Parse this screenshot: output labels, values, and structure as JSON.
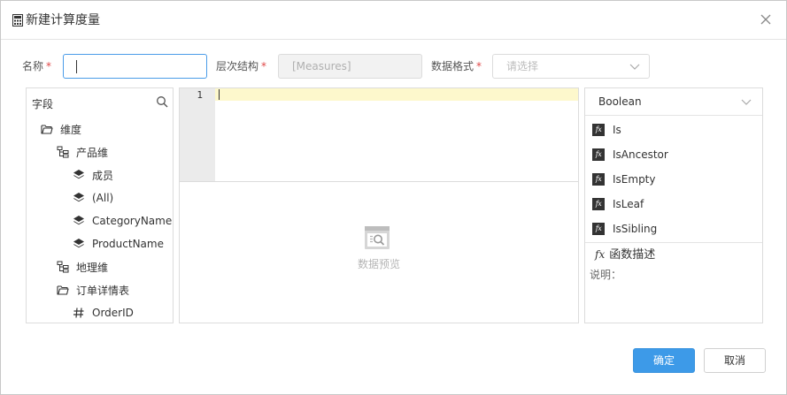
{
  "dialog": {
    "title": "新建计算度量",
    "icon": "calculator-icon",
    "close_icon": "close-icon"
  },
  "form": {
    "name_label": "名称",
    "required_mark": "*",
    "name_value": "",
    "hierarchy_label": "层次结构",
    "hierarchy_value": "[Measures]",
    "format_label": "数据格式",
    "format_placeholder": "请选择"
  },
  "field_panel": {
    "title": "字段",
    "items": [
      {
        "label": "维度",
        "icon": "folder-open-icon"
      },
      {
        "label": "产品维",
        "icon": "hierarchy-icon"
      },
      {
        "label": "成员",
        "icon": "layers-icon"
      },
      {
        "label": "(All)",
        "icon": "layers-icon"
      },
      {
        "label": "CategoryName",
        "icon": "layers-icon"
      },
      {
        "label": "ProductName",
        "icon": "layers-icon"
      },
      {
        "label": "地理维",
        "icon": "hierarchy-icon"
      },
      {
        "label": "订单详情表",
        "icon": "folder-open-icon"
      },
      {
        "label": "OrderID",
        "icon": "hash-icon"
      }
    ]
  },
  "editor": {
    "line_number": "1"
  },
  "preview": {
    "text": "数据预览",
    "icon": "data-preview-icon"
  },
  "function_panel": {
    "category": "Boolean",
    "functions": [
      {
        "fx": "fx",
        "name": "Is"
      },
      {
        "fx": "fx",
        "name": "IsAncestor"
      },
      {
        "fx": "fx",
        "name": "IsEmpty"
      },
      {
        "fx": "fx",
        "name": "IsLeaf"
      },
      {
        "fx": "fx",
        "name": "IsSibling"
      }
    ],
    "desc_fx": "fx",
    "desc_title": "函数描述",
    "desc_note": "说明："
  },
  "buttons": {
    "ok": "确定",
    "cancel": "取消"
  },
  "colors": {
    "primary": "#3d9ae8",
    "required": "#e04848",
    "active_line": "#fdf8cc"
  }
}
